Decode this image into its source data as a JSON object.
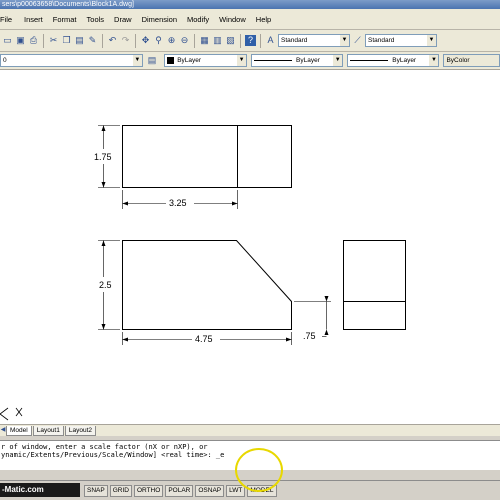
{
  "window": {
    "title": "sers\\p00063658\\Documents\\Block1A.dwg]"
  },
  "menu": [
    "File",
    "Insert",
    "Format",
    "Tools",
    "Draw",
    "Dimension",
    "Modify",
    "Window",
    "Help"
  ],
  "toolbar": {
    "text_style": "Standard",
    "dim_style": "Standard"
  },
  "properties": {
    "layer": "0",
    "color": "ByLayer",
    "linetype": "ByLayer",
    "lineweight": "ByLayer",
    "plotstyle": "ByColor"
  },
  "drawing": {
    "dim_height_top": "1.75",
    "dim_width_top": "3.25",
    "dim_height_bottom": "2.5",
    "dim_width_bottom": "4.75",
    "dim_step": ".75"
  },
  "tabs": [
    "Model",
    "Layout1",
    "Layout2"
  ],
  "command": {
    "line1": "r of window, enter a scale factor (nX or nXP), or",
    "line2": "ynamic/Extents/Previous/Scale/Window] <real time>: _e"
  },
  "status": [
    "SNAP",
    "GRID",
    "ORTHO",
    "POLAR",
    "OSNAP",
    "LWT",
    "MODEL"
  ],
  "watermark": "-Matic.com"
}
